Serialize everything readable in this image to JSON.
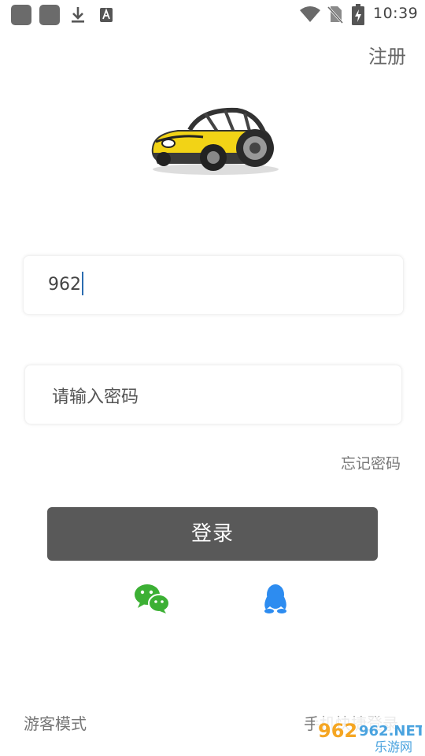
{
  "status_bar": {
    "time": "10:39",
    "icons": [
      "app-icon",
      "app-icon",
      "download-icon",
      "a-icon",
      "wifi-icon",
      "no-sim-icon",
      "battery-charging-icon"
    ]
  },
  "header": {
    "register_label": "注册"
  },
  "logo": {
    "name": "yellow-car-logo"
  },
  "form": {
    "username_value": "962",
    "password_placeholder": "请输入密码",
    "forgot_label": "忘记密码",
    "login_label": "登录"
  },
  "social": {
    "icons": [
      "wechat-icon",
      "qq-icon"
    ]
  },
  "footer": {
    "guest_label": "游客模式",
    "phone_login_label": "手机快捷登录"
  },
  "watermark": {
    "text_top": "962.NET",
    "text_bottom": "乐游网"
  },
  "colors": {
    "button_bg": "#595959",
    "wechat": "#3cb034",
    "qq": "#2d8cf0"
  }
}
